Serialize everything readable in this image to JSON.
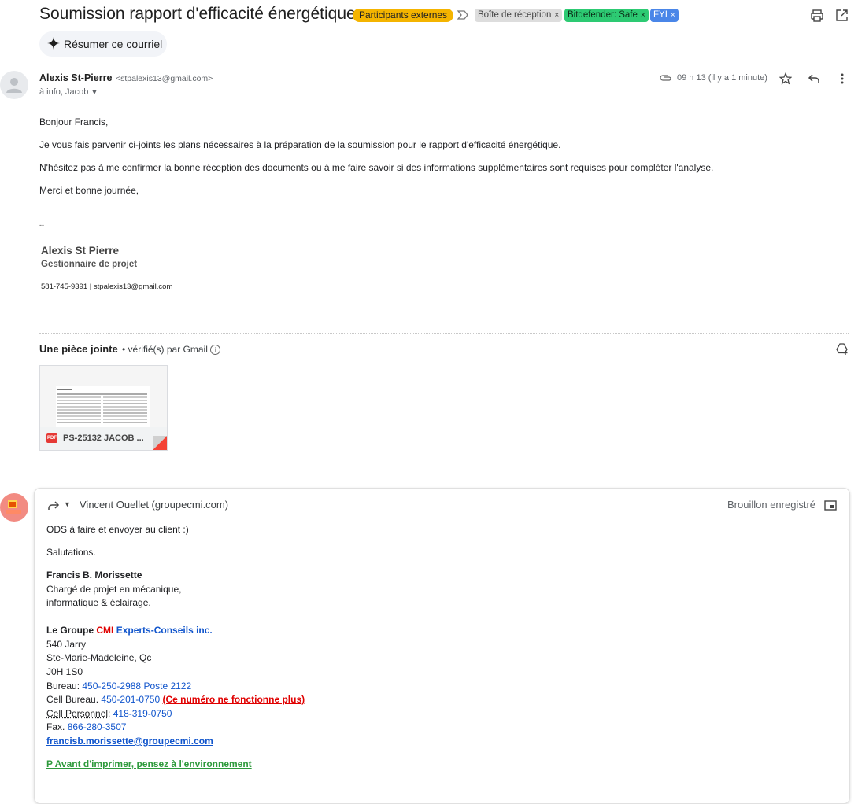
{
  "thread": {
    "subject": "Soumission rapport d'efficacité énergétique",
    "labels": {
      "external": "Participants externes",
      "inbox": "Boîte de réception",
      "bitdefender": "Bitdefender: Safe",
      "fyi": "FYI"
    },
    "summarize_label": "Résumer ce courriel"
  },
  "message": {
    "sender_name": "Alexis St-Pierre",
    "sender_email": "<stpalexis13@gmail.com>",
    "to_line": "à info, Jacob",
    "time": "09 h 13 (il y a 1 minute)",
    "body": {
      "greeting": "Bonjour Francis,",
      "p1": "Je vous fais parvenir ci-joints les plans nécessaires à la préparation de la soumission pour le rapport d'efficacité énergétique.",
      "p2": "N'hésitez pas à me confirmer la bonne réception des documents ou à me faire savoir si des informations supplémentaires sont requises pour compléter l'analyse.",
      "p3": "Merci et bonne journée,",
      "sep": "--"
    },
    "signature": {
      "name": "Alexis St Pierre",
      "title": "Gestionnaire de projet",
      "contact": "581-745-9391  |  stpalexis13@gmail.com"
    },
    "attachments": {
      "title": "Une pièce jointe",
      "verified": "• vérifié(s) par Gmail",
      "file_name": "PS-25132 JACOB ...",
      "file_type": "PDF"
    }
  },
  "reply": {
    "to": "Vincent Ouellet (groupecmi.com)",
    "status": "Brouillon enregistré",
    "line1": "ODS à faire et envoyer au client :)",
    "line2": "Salutations.",
    "sig": {
      "name": "Francis B. Morissette",
      "title1": "Chargé de projet en mécanique,",
      "title2": "informatique & éclairage.",
      "company_a": "Le Groupe",
      "company_b": "CMI",
      "company_c": "Experts-Conseils inc.",
      "addr1": "540 Jarry",
      "addr2": "Ste-Marie-Madeleine, Qc",
      "addr3": "J0H 1S0",
      "bureau_label": "Bureau:",
      "bureau_val": "450-250-2988 Poste 2122",
      "cellb_label": "Cell Bureau.",
      "cellb_val": "450-201-0750",
      "cellb_note": "(Ce numéro ne fonctionne plus)",
      "cellp_label": "Cell Personnel",
      "cellp_val": "418-319-0750",
      "fax_label": "Fax.",
      "fax_val": "866-280-3507",
      "email": "francisb.morissette@groupecmi.com",
      "eco": "P Avant d'imprimer, pensez à l'environnement"
    }
  },
  "colors": {
    "external_chip": "#f4b400",
    "bitdefender_chip": "#2dca73",
    "fyi_chip": "#4a86e8",
    "link_blue": "#1155cc",
    "warning_red": "#e00000",
    "eco_green": "#2e9a3c"
  }
}
